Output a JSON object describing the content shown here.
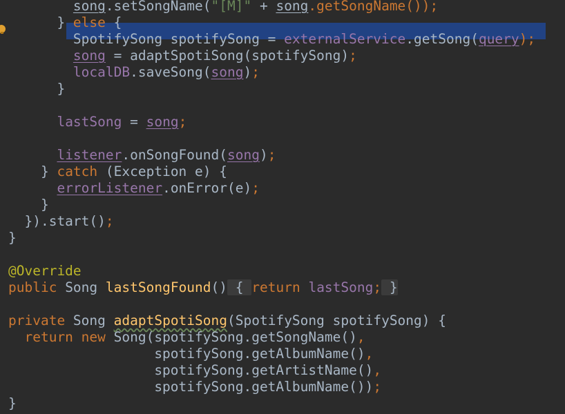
{
  "editor": {
    "language": "java",
    "colors": {
      "background": "#2b2b2b",
      "keyword": "#cc7832",
      "field": "#9876aa",
      "method_decl": "#ffc66d",
      "annotation": "#bbb529",
      "plain": "#a9b7c6",
      "selection": "#214283"
    },
    "gutter_icon": "intention-bulb-icon",
    "lines": [
      [
        {
          "t": "        ",
          "c": "pl"
        },
        {
          "t": "song",
          "c": "pl u"
        },
        {
          "t": ".setSongName(",
          "c": "pl"
        },
        {
          "t": "\"[M]\"",
          "c": "str"
        },
        {
          "t": " + ",
          "c": "pl"
        },
        {
          "t": "song",
          "c": "pl u"
        },
        {
          "t": ".getSongName());",
          "c": "kw"
        }
      ],
      [
        {
          "t": "      } ",
          "c": "pl"
        },
        {
          "t": "else",
          "c": "kw"
        },
        {
          "t": " {",
          "c": "pl"
        }
      ],
      [
        {
          "t": "        SpotifySong spotifySong = ",
          "c": "pl"
        },
        {
          "t": "externalService",
          "c": "fld"
        },
        {
          "t": ".getSong(",
          "c": "pl"
        },
        {
          "t": "query",
          "c": "fld u"
        },
        {
          "t": ");",
          "c": "kw"
        }
      ],
      [
        {
          "t": "        ",
          "c": "pl"
        },
        {
          "t": "song",
          "c": "fld u"
        },
        {
          "t": " = adaptSpotiSong(spotifySong)",
          "c": "pl"
        },
        {
          "t": ";",
          "c": "kw"
        }
      ],
      [
        {
          "t": "        ",
          "c": "pl"
        },
        {
          "t": "localDB",
          "c": "fld"
        },
        {
          "t": ".saveSong(",
          "c": "pl"
        },
        {
          "t": "song",
          "c": "fld u"
        },
        {
          "t": ")",
          "c": "pl"
        },
        {
          "t": ";",
          "c": "kw"
        }
      ],
      [
        {
          "t": "      }",
          "c": "pl"
        }
      ],
      [],
      [
        {
          "t": "      ",
          "c": "pl"
        },
        {
          "t": "lastSong",
          "c": "fld"
        },
        {
          "t": " = ",
          "c": "pl"
        },
        {
          "t": "song",
          "c": "fld u"
        },
        {
          "t": ";",
          "c": "kw"
        }
      ],
      [],
      [
        {
          "t": "      ",
          "c": "pl"
        },
        {
          "t": "listener",
          "c": "fld u"
        },
        {
          "t": ".onSongFound(",
          "c": "pl"
        },
        {
          "t": "song",
          "c": "fld u"
        },
        {
          "t": ")",
          "c": "pl"
        },
        {
          "t": ";",
          "c": "kw"
        }
      ],
      [
        {
          "t": "    } ",
          "c": "pl"
        },
        {
          "t": "catch",
          "c": "kw"
        },
        {
          "t": " (Exception e) {",
          "c": "pl"
        }
      ],
      [
        {
          "t": "      ",
          "c": "pl"
        },
        {
          "t": "errorListener",
          "c": "fld u"
        },
        {
          "t": ".onError(e)",
          "c": "pl"
        },
        {
          "t": ";",
          "c": "kw"
        }
      ],
      [
        {
          "t": "    }",
          "c": "pl"
        }
      ],
      [
        {
          "t": "  }).start()",
          "c": "pl"
        },
        {
          "t": ";",
          "c": "kw"
        }
      ],
      [
        {
          "t": "}",
          "c": "pl"
        }
      ],
      [],
      [
        {
          "t": "@Override",
          "c": "ann"
        }
      ],
      [
        {
          "t": "public",
          "c": "kw"
        },
        {
          "t": " Song ",
          "c": "pl"
        },
        {
          "t": "lastSongFound",
          "c": "fn"
        },
        {
          "t": "()",
          "c": "pl"
        },
        {
          "t": " { ",
          "c": "pl fold"
        },
        {
          "t": "return",
          "c": "kw"
        },
        {
          "t": " ",
          "c": "pl"
        },
        {
          "t": "lastSong",
          "c": "fld"
        },
        {
          "t": ";",
          "c": "kw"
        },
        {
          "t": " }",
          "c": "pl fold"
        }
      ],
      [],
      [
        {
          "t": "private",
          "c": "kw"
        },
        {
          "t": " Song ",
          "c": "pl"
        },
        {
          "t": "adaptSpotiSong",
          "c": "fn wavy"
        },
        {
          "t": "(SpotifySong spotifySong) {",
          "c": "pl"
        }
      ],
      [
        {
          "t": "  ",
          "c": "pl"
        },
        {
          "t": "return new",
          "c": "kw"
        },
        {
          "t": " Song(spotifySong.getSongName()",
          "c": "pl"
        },
        {
          "t": ",",
          "c": "kw"
        }
      ],
      [
        {
          "t": "                  spotifySong.getAlbumName()",
          "c": "pl"
        },
        {
          "t": ",",
          "c": "kw"
        }
      ],
      [
        {
          "t": "                  spotifySong.getArtistName()",
          "c": "pl"
        },
        {
          "t": ",",
          "c": "kw"
        }
      ],
      [
        {
          "t": "                  spotifySong.getAlbumName())",
          "c": "pl"
        },
        {
          "t": ";",
          "c": "kw"
        }
      ],
      [
        {
          "t": "}",
          "c": "pl"
        }
      ]
    ]
  }
}
